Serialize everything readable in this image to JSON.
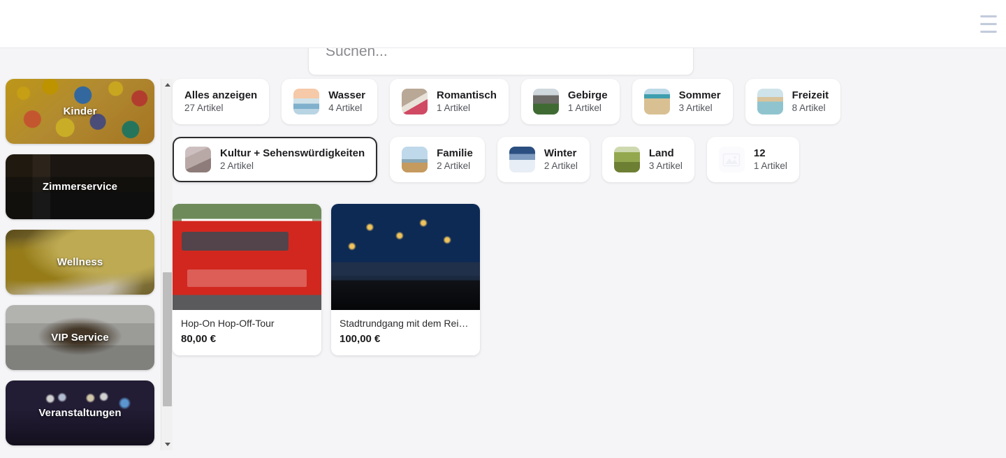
{
  "header": {
    "menu_icon": "hamburger-menu-icon"
  },
  "search": {
    "value": "",
    "placeholder": "Suchen..."
  },
  "sidebar": {
    "items": [
      {
        "label": "Kinder",
        "image": "rubber-ducks-photo"
      },
      {
        "label": "Zimmerservice",
        "image": "hotel-room-lounge-photo"
      },
      {
        "label": "Wellness",
        "image": "spa-candle-photo"
      },
      {
        "label": "VIP Service",
        "image": "private-jet-cabin-photo"
      },
      {
        "label": "Veranstaltungen",
        "image": "concert-crowd-photo"
      }
    ],
    "scrollbar": {
      "up_arrow": "scroll-up-arrow-icon",
      "down_arrow": "scroll-down-arrow-icon"
    }
  },
  "categories": [
    {
      "name": "Alles anzeigen",
      "count": "27 Artikel",
      "thumb": "none",
      "selected": false
    },
    {
      "name": "Wasser",
      "count": "4 Artikel",
      "thumb": "t-wasser",
      "selected": false
    },
    {
      "name": "Romantisch",
      "count": "1 Artikel",
      "thumb": "t-roman",
      "selected": false
    },
    {
      "name": "Gebirge",
      "count": "1 Artikel",
      "thumb": "t-gebirge",
      "selected": false
    },
    {
      "name": "Sommer",
      "count": "3 Artikel",
      "thumb": "t-sommer",
      "selected": false
    },
    {
      "name": "Freizeit",
      "count": "8 Artikel",
      "thumb": "t-freizeit",
      "selected": false
    },
    {
      "name": "Kultur + Sehenswürdigkeiten",
      "count": "2 Artikel",
      "thumb": "t-kultur",
      "selected": true
    },
    {
      "name": "Familie",
      "count": "2 Artikel",
      "thumb": "t-familie",
      "selected": false
    },
    {
      "name": "Winter",
      "count": "2 Artikel",
      "thumb": "t-winter",
      "selected": false
    },
    {
      "name": "Land",
      "count": "3 Artikel",
      "thumb": "t-land",
      "selected": false
    },
    {
      "name": "12",
      "count": "1 Artikel",
      "thumb": "t-placeholder",
      "selected": false
    }
  ],
  "products": [
    {
      "name": "Hop-On Hop-Off-Tour",
      "price": "80,00 €",
      "image": "red-double-decker-bus-photo"
    },
    {
      "name": "Stadtrundgang mit dem Reis…",
      "price": "100,00 €",
      "image": "christmas-market-night-photo"
    }
  ],
  "colors": {
    "page_background": "#f5f5f7",
    "card_background": "#ffffff",
    "selected_border": "#2c2c2e",
    "menu_icon": "#c3cbdc",
    "scrollbar_thumb": "#bdbdbd",
    "text_primary": "#1d1d20",
    "text_secondary": "#53555c"
  }
}
